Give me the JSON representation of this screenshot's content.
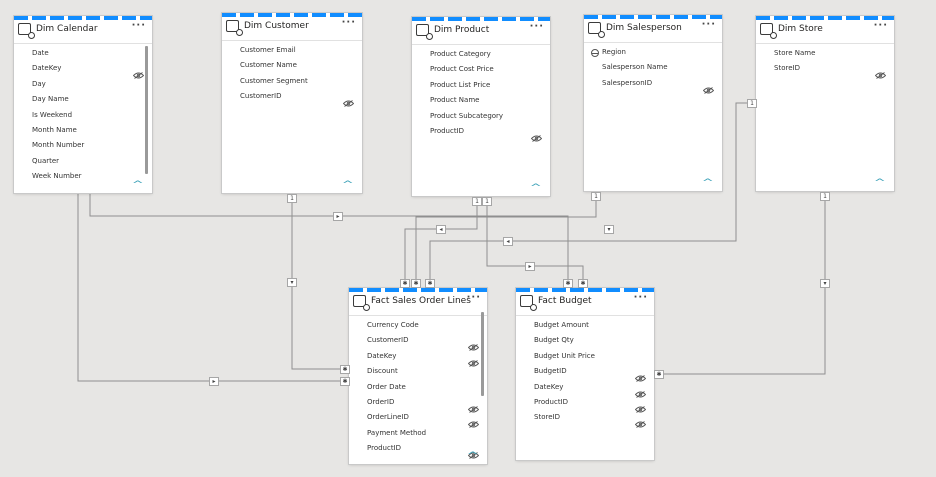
{
  "tables": {
    "dim_calendar": {
      "title": "Dim Calendar",
      "fields": [
        {
          "name": "Date",
          "hidden": false
        },
        {
          "name": "DateKey",
          "hidden": true
        },
        {
          "name": "Day",
          "hidden": false
        },
        {
          "name": "Day Name",
          "hidden": false
        },
        {
          "name": "Is Weekend",
          "hidden": false
        },
        {
          "name": "Month Name",
          "hidden": false
        },
        {
          "name": "Month Number",
          "hidden": false
        },
        {
          "name": "Quarter",
          "hidden": false
        },
        {
          "name": "Week Number",
          "hidden": false
        }
      ]
    },
    "dim_customer": {
      "title": "Dim Customer",
      "fields": [
        {
          "name": "Customer Email",
          "hidden": false
        },
        {
          "name": "Customer Name",
          "hidden": false
        },
        {
          "name": "Customer Segment",
          "hidden": false
        },
        {
          "name": "CustomerID",
          "hidden": true
        }
      ]
    },
    "dim_product": {
      "title": "Dim Product",
      "fields": [
        {
          "name": "Product Category",
          "hidden": false
        },
        {
          "name": "Product Cost Price",
          "hidden": false
        },
        {
          "name": "Product List Price",
          "hidden": false
        },
        {
          "name": "Product Name",
          "hidden": false
        },
        {
          "name": "Product Subcategory",
          "hidden": false
        },
        {
          "name": "ProductID",
          "hidden": true
        }
      ]
    },
    "dim_salesperson": {
      "title": "Dim Salesperson",
      "fields": [
        {
          "name": "Region",
          "hidden": false,
          "hierarchy": true
        },
        {
          "name": "Salesperson Name",
          "hidden": false
        },
        {
          "name": "SalespersonID",
          "hidden": true
        }
      ]
    },
    "dim_store": {
      "title": "Dim Store",
      "fields": [
        {
          "name": "Store Name",
          "hidden": false
        },
        {
          "name": "StoreID",
          "hidden": true
        }
      ]
    },
    "fact_sales": {
      "title": "Fact Sales Order Lines",
      "fields": [
        {
          "name": "Currency Code",
          "hidden": false
        },
        {
          "name": "CustomerID",
          "hidden": true
        },
        {
          "name": "DateKey",
          "hidden": true
        },
        {
          "name": "Discount",
          "hidden": false
        },
        {
          "name": "Order Date",
          "hidden": false
        },
        {
          "name": "OrderID",
          "hidden": true
        },
        {
          "name": "OrderLineID",
          "hidden": true
        },
        {
          "name": "Payment Method",
          "hidden": false
        },
        {
          "name": "ProductID",
          "hidden": true
        }
      ]
    },
    "fact_budget": {
      "title": "Fact Budget",
      "fields": [
        {
          "name": "Budget Amount",
          "hidden": false
        },
        {
          "name": "Budget Qty",
          "hidden": false
        },
        {
          "name": "Budget Unit Price",
          "hidden": false
        },
        {
          "name": "BudgetID",
          "hidden": true
        },
        {
          "name": "DateKey",
          "hidden": true
        },
        {
          "name": "ProductID",
          "hidden": true
        },
        {
          "name": "StoreID",
          "hidden": true
        }
      ]
    }
  },
  "labels": {
    "more": "···",
    "collapse": "^",
    "one": "1",
    "many": "✱",
    "filter_right": "▸",
    "filter_left": "◂",
    "filter_down": "▾"
  },
  "colors": {
    "accent": "#118dff",
    "canvas": "#e7e6e4",
    "line": "#8f8f8f"
  }
}
